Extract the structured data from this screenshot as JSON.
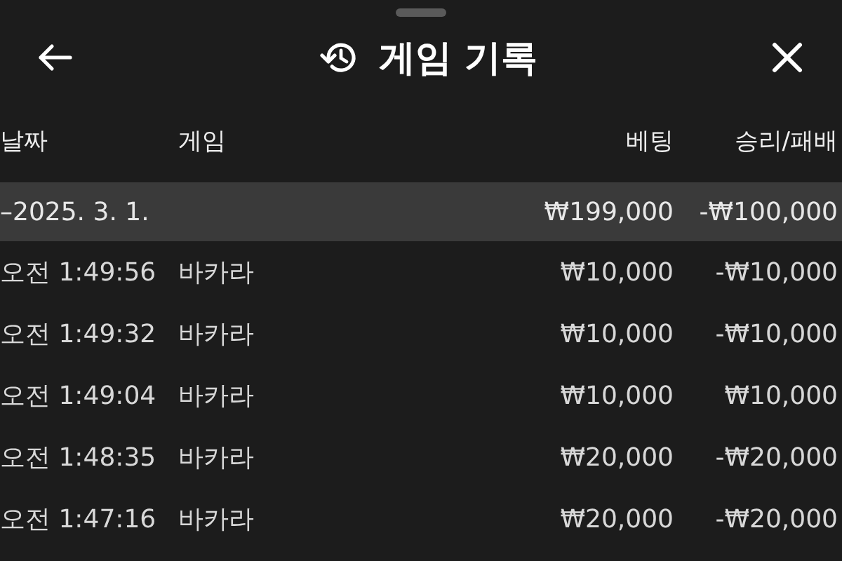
{
  "header": {
    "title": "게임 기록"
  },
  "table": {
    "columns": [
      "날짜",
      "게임",
      "베팅",
      "승리/패배"
    ],
    "rows": [
      {
        "kind": "group",
        "date": "–2025. 3. 1.",
        "game": null,
        "bet": "₩199,000",
        "result": "-₩100,000"
      },
      {
        "kind": "game",
        "date": "오전 1:49:56",
        "game": "바카라",
        "bet": "₩10,000",
        "result": "-₩10,000"
      },
      {
        "kind": "game",
        "date": "오전 1:49:32",
        "game": "바카라",
        "bet": "₩10,000",
        "result": "-₩10,000"
      },
      {
        "kind": "game",
        "date": "오전 1:49:04",
        "game": "바카라",
        "bet": "₩10,000",
        "result": "₩10,000"
      },
      {
        "kind": "game",
        "date": "오전 1:48:35",
        "game": "바카라",
        "bet": "₩20,000",
        "result": "-₩20,000"
      },
      {
        "kind": "game",
        "date": "오전 1:47:16",
        "game": "바카라",
        "bet": "₩20,000",
        "result": "-₩20,000"
      }
    ]
  }
}
